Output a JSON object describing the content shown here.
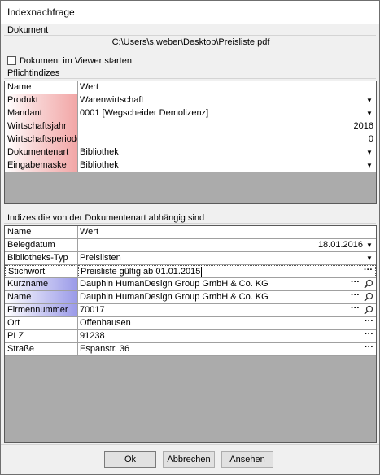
{
  "window": {
    "title": "Indexnachfrage"
  },
  "document": {
    "section_label": "Dokument",
    "path": "C:\\Users\\s.weber\\Desktop\\Preisliste.pdf",
    "open_in_viewer_label": "Dokument im Viewer starten",
    "open_in_viewer_checked": false
  },
  "required": {
    "section_label": "Pflichtindizes",
    "col_name": "Name",
    "col_value": "Wert",
    "rows": [
      {
        "name": "Produkt",
        "value": "Warenwirtschaft",
        "control": "dropdown"
      },
      {
        "name": "Mandant",
        "value": "0001 [Wegscheider Demolizenz]",
        "control": "dropdown"
      },
      {
        "name": "Wirtschaftsjahr",
        "value": "2016",
        "control": "number"
      },
      {
        "name": "Wirtschaftsperiode",
        "value": "0",
        "control": "number"
      },
      {
        "name": "Dokumentenart",
        "value": "Bibliothek",
        "control": "dropdown"
      },
      {
        "name": "Eingabemaske",
        "value": "Bibliothek",
        "control": "dropdown"
      }
    ]
  },
  "dependent": {
    "section_label": "Indizes die von der Dokumentenart abhängig sind",
    "col_name": "Name",
    "col_value": "Wert",
    "rows": [
      {
        "name": "Belegdatum",
        "value": "18.01.2016",
        "control": "date"
      },
      {
        "name": "Bibliotheks-Typ",
        "value": "Preislisten",
        "control": "dropdown"
      },
      {
        "name": "Stichwort",
        "value": "Preisliste gültig ab 01.01.2015",
        "control": "text-editing"
      },
      {
        "name": "Kurzname",
        "value": "Dauphin HumanDesign Group GmbH & Co. KG",
        "control": "lookup"
      },
      {
        "name": "Name",
        "value": "Dauphin HumanDesign Group GmbH & Co. KG",
        "control": "lookup"
      },
      {
        "name": "Firmennummer",
        "value": "70017",
        "control": "lookup"
      },
      {
        "name": "Ort",
        "value": "Offenhausen",
        "control": "ellipsis"
      },
      {
        "name": "PLZ",
        "value": "91238",
        "control": "ellipsis"
      },
      {
        "name": "Straße",
        "value": "Espanstr. 36",
        "control": "ellipsis"
      }
    ]
  },
  "buttons": {
    "ok": "Ok",
    "cancel": "Abbrechen",
    "view": "Ansehen"
  },
  "icons": {
    "dropdown": "chevron-down-icon",
    "ellipsis": "ellipsis-icon",
    "lookup": "magnifier-icon"
  },
  "colors": {
    "required_highlight": "#f2a6a6",
    "lookup_highlight": "#9a9ae8"
  }
}
